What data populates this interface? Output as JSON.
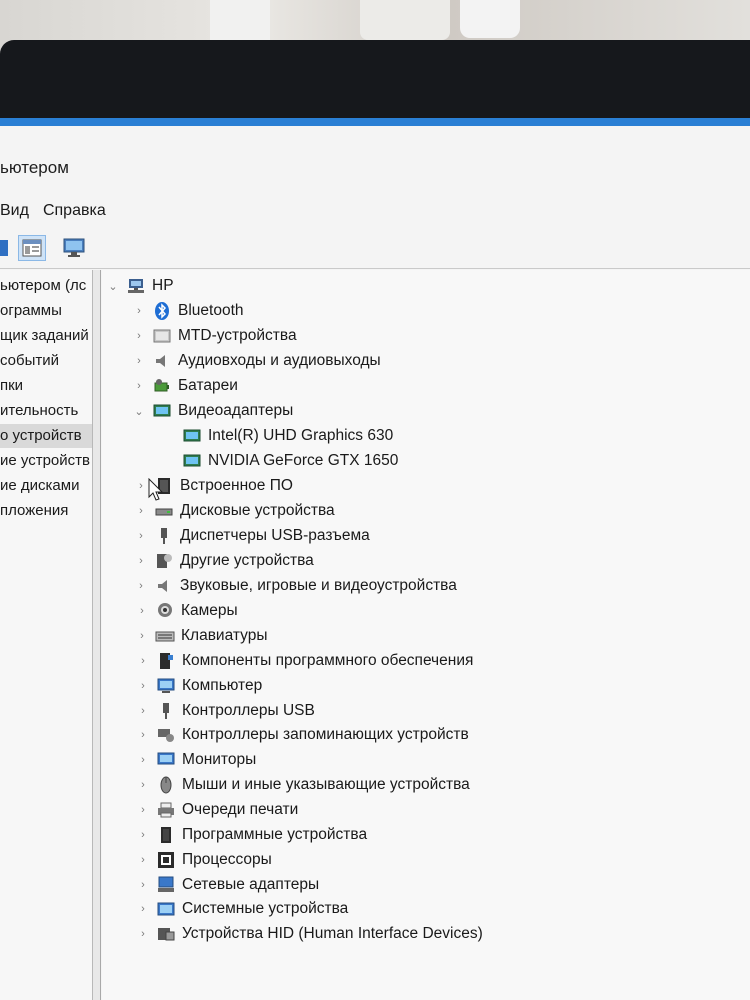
{
  "window": {
    "title": "ьютером"
  },
  "menu": {
    "items": [
      "Вид",
      "Справка"
    ]
  },
  "toolbar": {
    "buttons": [
      "view-toggle-icon",
      "properties-icon",
      "scan-hardware-icon"
    ]
  },
  "left_pane": {
    "items": [
      {
        "label": "ьютером (лс",
        "selected": false
      },
      {
        "label": "ограммы",
        "selected": false
      },
      {
        "label": "щик заданий",
        "selected": false
      },
      {
        "label": "событий",
        "selected": false
      },
      {
        "label": "пки",
        "selected": false
      },
      {
        "label": "ительность",
        "selected": false
      },
      {
        "label": "о устройств",
        "selected": true
      },
      {
        "label": "ие устройств",
        "selected": false
      },
      {
        "label": "ие дисками",
        "selected": false
      },
      {
        "label": "пложения",
        "selected": false
      }
    ]
  },
  "tree": {
    "root": "HP",
    "categories": [
      {
        "label": "Bluetooth",
        "icon": "bluetooth-icon",
        "expanded": false
      },
      {
        "label": "MTD-устройства",
        "icon": "mtd-device-icon",
        "expanded": false
      },
      {
        "label": "Аудиовходы и аудиовыходы",
        "icon": "speaker-icon",
        "expanded": false
      },
      {
        "label": "Батареи",
        "icon": "battery-icon",
        "expanded": false
      },
      {
        "label": "Видеоадаптеры",
        "icon": "display-adapter-icon",
        "expanded": true,
        "children": [
          {
            "label": "Intel(R) UHD Graphics 630",
            "icon": "display-adapter-icon"
          },
          {
            "label": "NVIDIA GeForce GTX 1650",
            "icon": "display-adapter-icon"
          }
        ]
      },
      {
        "label": "Встроенное ПО",
        "icon": "firmware-icon",
        "expanded": false
      },
      {
        "label": "Дисковые устройства",
        "icon": "disk-drive-icon",
        "expanded": false
      },
      {
        "label": "Диспетчеры USB-разъема",
        "icon": "usb-connector-icon",
        "expanded": false
      },
      {
        "label": "Другие устройства",
        "icon": "unknown-device-icon",
        "expanded": false
      },
      {
        "label": "Звуковые, игровые и видеоустройства",
        "icon": "sound-icon",
        "expanded": false
      },
      {
        "label": "Камеры",
        "icon": "camera-icon",
        "expanded": false
      },
      {
        "label": "Клавиатуры",
        "icon": "keyboard-icon",
        "expanded": false
      },
      {
        "label": "Компоненты программного обеспечения",
        "icon": "software-component-icon",
        "expanded": false
      },
      {
        "label": "Компьютер",
        "icon": "computer-icon",
        "expanded": false
      },
      {
        "label": "Контроллеры USB",
        "icon": "usb-icon",
        "expanded": false
      },
      {
        "label": "Контроллеры запоминающих устройств",
        "icon": "storage-controller-icon",
        "expanded": false
      },
      {
        "label": "Мониторы",
        "icon": "monitor-icon",
        "expanded": false
      },
      {
        "label": "Мыши и иные указывающие устройства",
        "icon": "mouse-icon",
        "expanded": false
      },
      {
        "label": "Очереди печати",
        "icon": "printer-icon",
        "expanded": false
      },
      {
        "label": "Программные устройства",
        "icon": "software-device-icon",
        "expanded": false
      },
      {
        "label": "Процессоры",
        "icon": "processor-icon",
        "expanded": false
      },
      {
        "label": "Сетевые адаптеры",
        "icon": "network-adapter-icon",
        "expanded": false
      },
      {
        "label": "Системные устройства",
        "icon": "system-device-icon",
        "expanded": false
      },
      {
        "label": "Устройства HID (Human Interface Devices)",
        "icon": "hid-icon",
        "expanded": false
      }
    ]
  },
  "colors": {
    "accent": "#2a7fd4",
    "selected_bg": "#d9d9d9",
    "bezel": "#16181c"
  }
}
